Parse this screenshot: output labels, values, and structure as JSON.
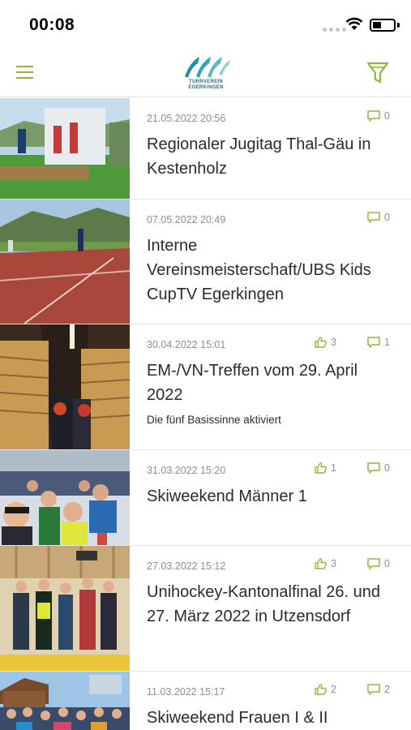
{
  "status_bar": {
    "time": "00:08"
  },
  "header": {
    "logo_text": "TURNVEREIN EGERKINGEN",
    "accent_color": "#8db83e"
  },
  "feed": [
    {
      "date": "21.05.2022 20:56",
      "title": "Regionaler Jugitag Thal-Gäu in Kestenholz",
      "likes": null,
      "comments": "0"
    },
    {
      "date": "07.05.2022 20:49",
      "title": "Interne Vereinsmeisterschaft/UBS Kids CupTV Egerkingen",
      "likes": null,
      "comments": "0"
    },
    {
      "date": "30.04.2022 15:01",
      "title": "EM-/VN-Treffen vom 29. April 2022",
      "subtitle": "Die fünf Basissinne aktiviert",
      "likes": "3",
      "comments": "1"
    },
    {
      "date": "31.03.2022 15:20",
      "title": "Skiweekend Männer 1",
      "likes": "1",
      "comments": "0"
    },
    {
      "date": "27.03.2022 15:12",
      "title": "Unihockey-Kantonalfinal 26. und 27. März 2022 in Utzensdorf",
      "likes": "3",
      "comments": "0"
    },
    {
      "date": "11.03.2022 15:17",
      "title": "Skiweekend Frauen I & II",
      "likes": "2",
      "comments": "2"
    }
  ]
}
